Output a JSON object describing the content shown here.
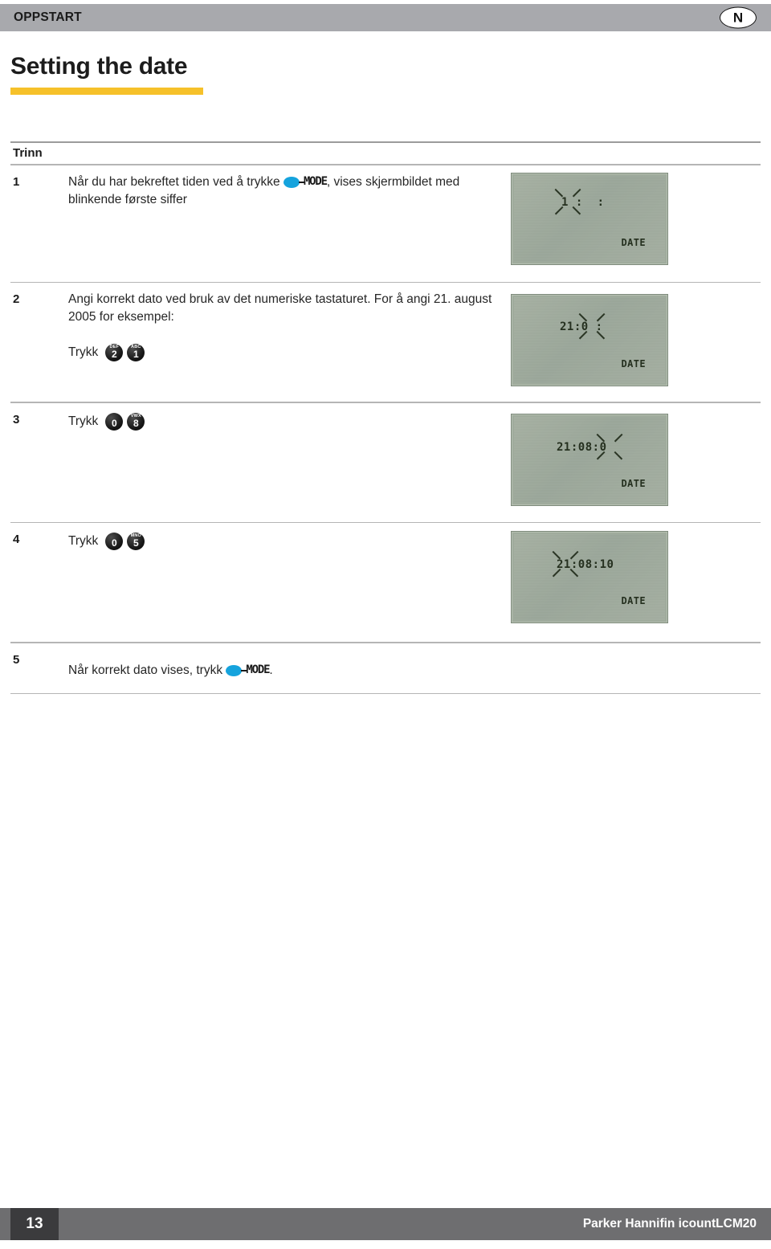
{
  "header": {
    "section_label": "OPPSTART",
    "country_code": "N"
  },
  "title": {
    "text": "Setting the date",
    "rule_color": "#f6c12a"
  },
  "table": {
    "column_header": "Trinn",
    "press_label": "Trykk",
    "mode_word": "MODE",
    "mode_dot_color": "#15a3dd",
    "steps": [
      {
        "num": "1",
        "text_before_mode": "Når du har bekreftet tiden ved å trykke ",
        "text_after_mode": ", vises skjermbildet med blinkende første siffer",
        "keys": [],
        "lcd": {
          "time": "1 :  :",
          "label": "DATE"
        }
      },
      {
        "num": "2",
        "text_before_mode": "Angi korrekt dato ved bruk av det numeriske tastaturet. For å angi 21. august 2005 for eksempel:",
        "text_after_mode": "",
        "keys": [
          {
            "digit": "2",
            "letters": "DEF"
          },
          {
            "digit": "1",
            "letters": "ABC"
          }
        ],
        "lcd": {
          "time": "21:0 :",
          "label": "DATE"
        }
      },
      {
        "num": "3",
        "text_before_mode": "",
        "text_after_mode": "",
        "keys": [
          {
            "digit": "0",
            "letters": ""
          },
          {
            "digit": "8",
            "letters": "VWX"
          }
        ],
        "lcd": {
          "time": "21:08:0",
          "label": "DATE"
        }
      },
      {
        "num": "4",
        "text_before_mode": "",
        "text_after_mode": "",
        "keys": [
          {
            "digit": "0",
            "letters": ""
          },
          {
            "digit": "5",
            "letters": "MNO"
          }
        ],
        "lcd": {
          "time": "21:08:10",
          "label": "DATE"
        }
      },
      {
        "num": "5",
        "text_before_mode": "Når korrekt dato vises, trykk ",
        "text_after_mode": ".",
        "keys": [],
        "lcd": null
      }
    ]
  },
  "footer": {
    "page_number": "13",
    "product": "Parker Hannifin icountLCM20"
  }
}
